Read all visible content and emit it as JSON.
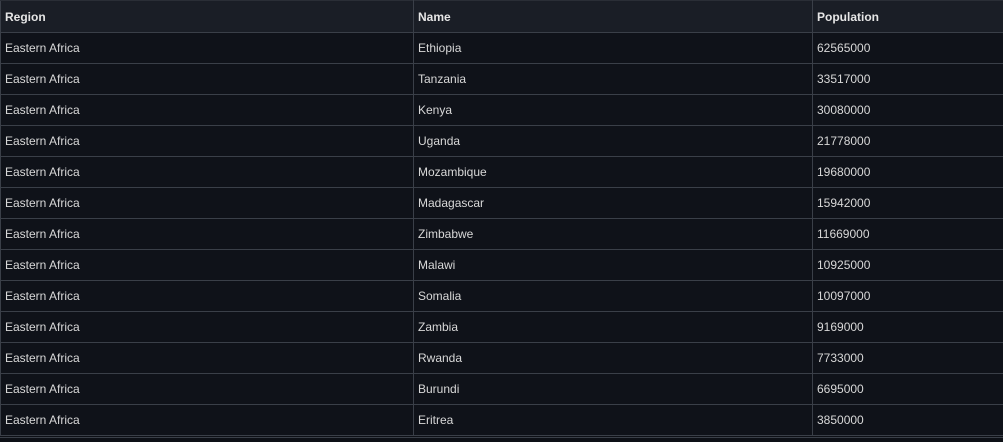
{
  "table": {
    "columns": [
      "Region",
      "Name",
      "Population"
    ],
    "rows": [
      {
        "region": "Eastern Africa",
        "name": "Ethiopia",
        "population": "62565000"
      },
      {
        "region": "Eastern Africa",
        "name": "Tanzania",
        "population": "33517000"
      },
      {
        "region": "Eastern Africa",
        "name": "Kenya",
        "population": "30080000"
      },
      {
        "region": "Eastern Africa",
        "name": "Uganda",
        "population": "21778000"
      },
      {
        "region": "Eastern Africa",
        "name": "Mozambique",
        "population": "19680000"
      },
      {
        "region": "Eastern Africa",
        "name": "Madagascar",
        "population": "15942000"
      },
      {
        "region": "Eastern Africa",
        "name": "Zimbabwe",
        "population": "11669000"
      },
      {
        "region": "Eastern Africa",
        "name": "Malawi",
        "population": "10925000"
      },
      {
        "region": "Eastern Africa",
        "name": "Somalia",
        "population": "10097000"
      },
      {
        "region": "Eastern Africa",
        "name": "Zambia",
        "population": "9169000"
      },
      {
        "region": "Eastern Africa",
        "name": "Rwanda",
        "population": "7733000"
      },
      {
        "region": "Eastern Africa",
        "name": "Burundi",
        "population": "6695000"
      },
      {
        "region": "Eastern Africa",
        "name": "Eritrea",
        "population": "3850000"
      }
    ]
  },
  "colors": {
    "background": "#0d1016",
    "header_background": "#1a1e26",
    "cell_background": "#0f1219",
    "border": "#3a3f48",
    "text": "#d8d8d8"
  }
}
